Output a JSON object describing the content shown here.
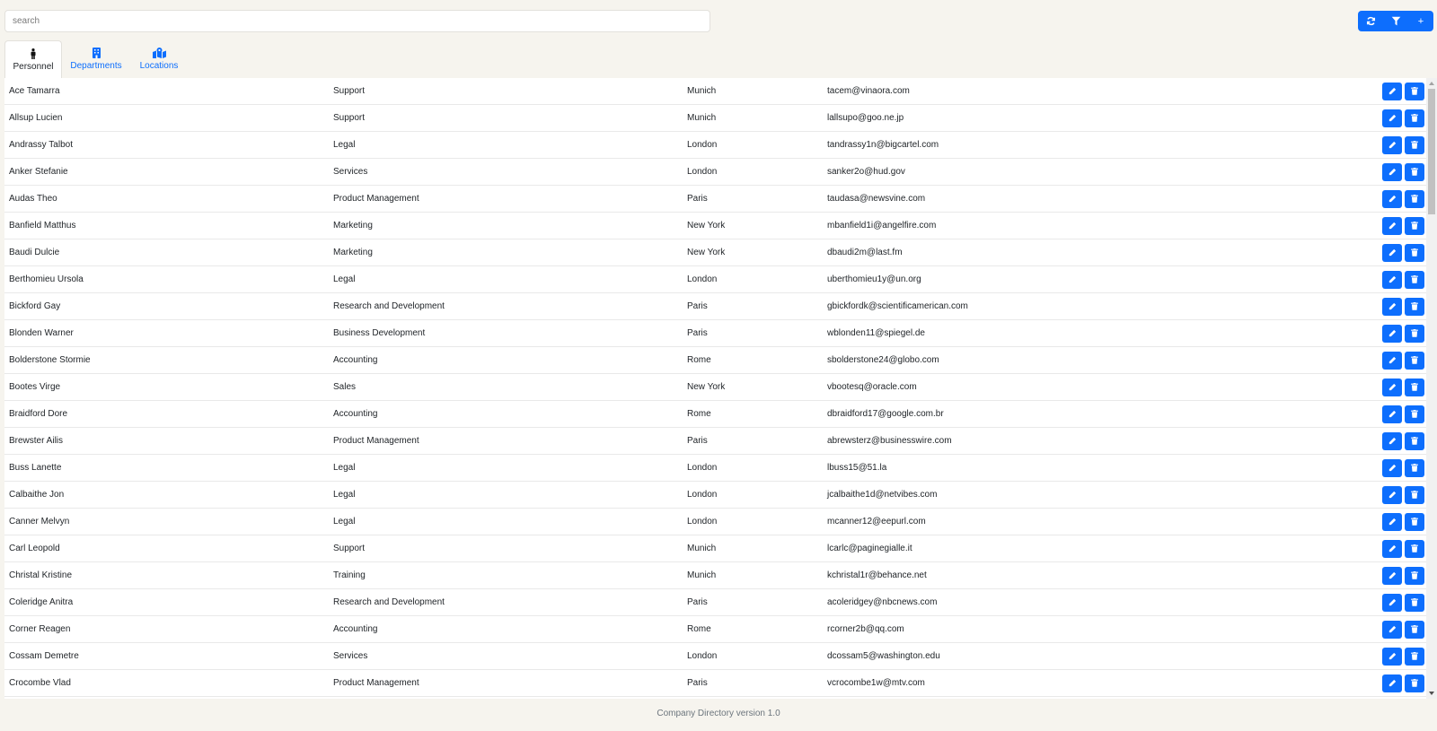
{
  "search": {
    "placeholder": "search",
    "value": ""
  },
  "toolbar": {
    "refresh_icon": "refresh-icon",
    "filter_icon": "filter-icon",
    "add_label": "+"
  },
  "tabs": [
    {
      "label": "Personnel",
      "icon": "person-icon",
      "active": true
    },
    {
      "label": "Departments",
      "icon": "building-icon",
      "active": false
    },
    {
      "label": "Locations",
      "icon": "map-location-icon",
      "active": false
    }
  ],
  "personnel": [
    {
      "name": "Ace Tamarra",
      "department": "Support",
      "location": "Munich",
      "email": "tacem@vinaora.com"
    },
    {
      "name": "Allsup Lucien",
      "department": "Support",
      "location": "Munich",
      "email": "lallsupo@goo.ne.jp"
    },
    {
      "name": "Andrassy Talbot",
      "department": "Legal",
      "location": "London",
      "email": "tandrassy1n@bigcartel.com"
    },
    {
      "name": "Anker Stefanie",
      "department": "Services",
      "location": "London",
      "email": "sanker2o@hud.gov"
    },
    {
      "name": "Audas Theo",
      "department": "Product Management",
      "location": "Paris",
      "email": "taudasa@newsvine.com"
    },
    {
      "name": "Banfield Matthus",
      "department": "Marketing",
      "location": "New York",
      "email": "mbanfield1i@angelfire.com"
    },
    {
      "name": "Baudi Dulcie",
      "department": "Marketing",
      "location": "New York",
      "email": "dbaudi2m@last.fm"
    },
    {
      "name": "Berthomieu Ursola",
      "department": "Legal",
      "location": "London",
      "email": "uberthomieu1y@un.org"
    },
    {
      "name": "Bickford Gay",
      "department": "Research and Development",
      "location": "Paris",
      "email": "gbickfordk@scientificamerican.com"
    },
    {
      "name": "Blonden Warner",
      "department": "Business Development",
      "location": "Paris",
      "email": "wblonden11@spiegel.de"
    },
    {
      "name": "Bolderstone Stormie",
      "department": "Accounting",
      "location": "Rome",
      "email": "sbolderstone24@globo.com"
    },
    {
      "name": "Bootes Virge",
      "department": "Sales",
      "location": "New York",
      "email": "vbootesq@oracle.com"
    },
    {
      "name": "Braidford Dore",
      "department": "Accounting",
      "location": "Rome",
      "email": "dbraidford17@google.com.br"
    },
    {
      "name": "Brewster Ailis",
      "department": "Product Management",
      "location": "Paris",
      "email": "abrewsterz@businesswire.com"
    },
    {
      "name": "Buss Lanette",
      "department": "Legal",
      "location": "London",
      "email": "lbuss15@51.la"
    },
    {
      "name": "Calbaithe Jon",
      "department": "Legal",
      "location": "London",
      "email": "jcalbaithe1d@netvibes.com"
    },
    {
      "name": "Canner Melvyn",
      "department": "Legal",
      "location": "London",
      "email": "mcanner12@eepurl.com"
    },
    {
      "name": "Carl Leopold",
      "department": "Support",
      "location": "Munich",
      "email": "lcarlc@paginegialle.it"
    },
    {
      "name": "Christal Kristine",
      "department": "Training",
      "location": "Munich",
      "email": "kchristal1r@behance.net"
    },
    {
      "name": "Coleridge Anitra",
      "department": "Research and Development",
      "location": "Paris",
      "email": "acoleridgey@nbcnews.com"
    },
    {
      "name": "Corner Reagen",
      "department": "Accounting",
      "location": "Rome",
      "email": "rcorner2b@qq.com"
    },
    {
      "name": "Cossam Demetre",
      "department": "Services",
      "location": "London",
      "email": "dcossam5@washington.edu"
    },
    {
      "name": "Crocombe Vlad",
      "department": "Product Management",
      "location": "Paris",
      "email": "vcrocombe1w@mtv.com"
    }
  ],
  "footer": {
    "text": "Company Directory version 1.0"
  },
  "colors": {
    "accent": "#0d6efd",
    "background": "#f6f4ee"
  }
}
